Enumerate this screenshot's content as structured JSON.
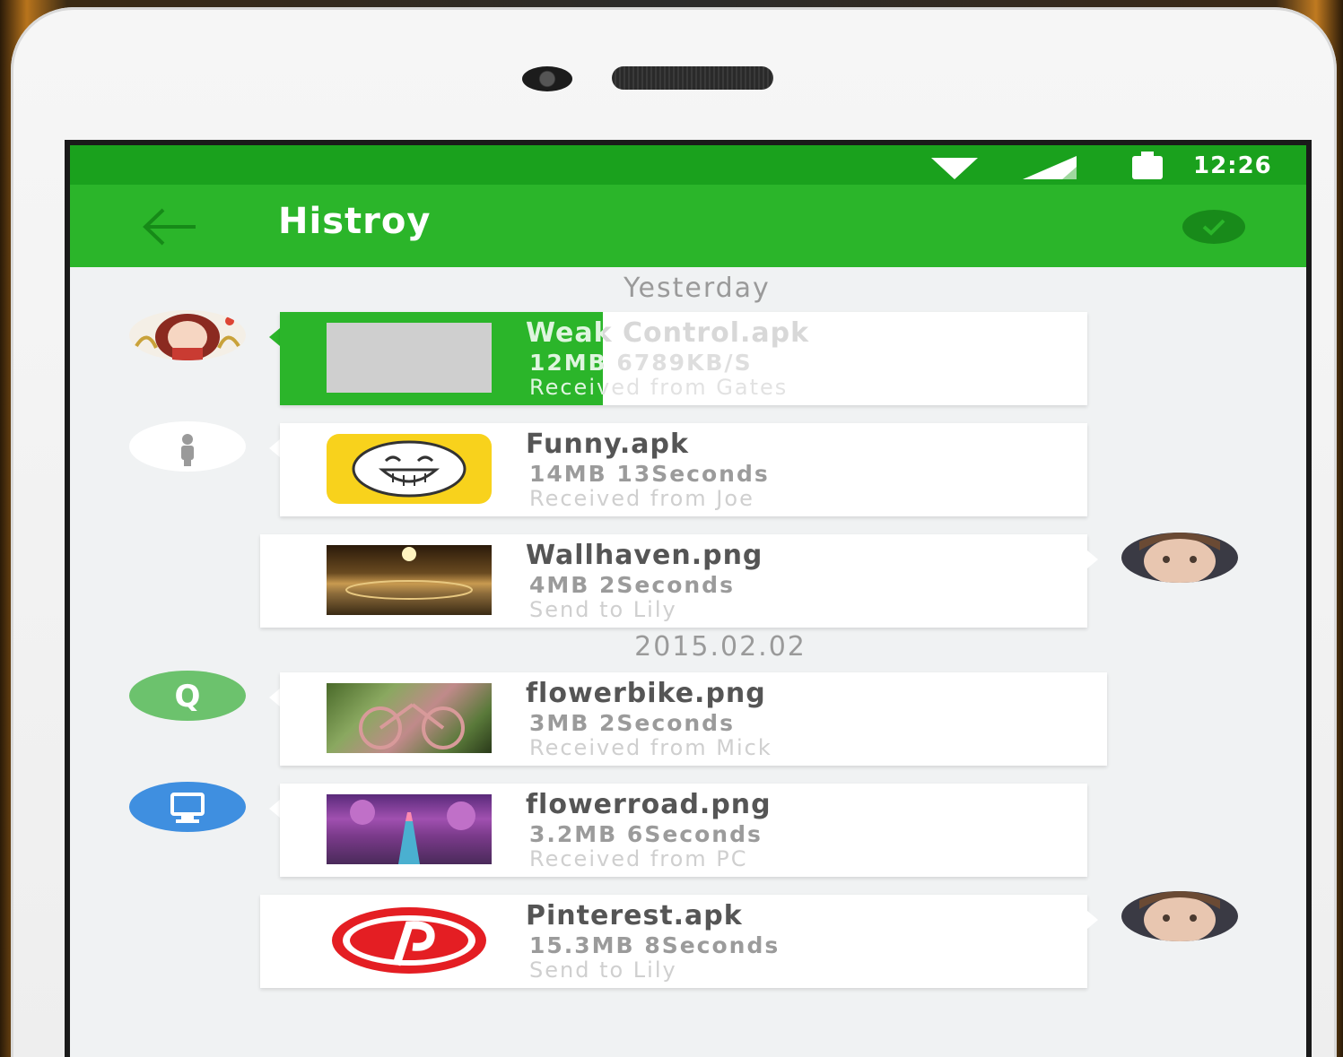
{
  "status": {
    "time": "12:26"
  },
  "appbar": {
    "title": "Histroy"
  },
  "colors": {
    "primary": "#2bb52a",
    "status_bar": "#1aa11d",
    "check_badge": "#188a1a",
    "background": "#f0f2f3"
  },
  "groups": [
    {
      "date": "Yesterday"
    },
    {
      "date": "2015.02.02"
    }
  ],
  "items": [
    {
      "name": "Weak Control.apk",
      "meta": "12MB 6789KB/S",
      "detail": "Received from Gates",
      "direction": "received",
      "progress": 0.4,
      "avatar_icon": "girl-avatar-icon",
      "thumb_icon": "placeholder-thumb"
    },
    {
      "name": "Funny.apk",
      "meta": "14MB 13Seconds",
      "detail": "Received from Joe",
      "direction": "received",
      "avatar_icon": "person-icon",
      "thumb_icon": "laughing-face-icon"
    },
    {
      "name": "Wallhaven.png",
      "meta": "4MB 2Seconds",
      "detail": "Send to Lily",
      "direction": "sent",
      "avatar_icon": "lily-avatar-icon",
      "thumb_icon": "wallpaper-thumb"
    },
    {
      "name": "flowerbike.png",
      "meta": "3MB 2Seconds",
      "detail": "Received from Mick",
      "direction": "received",
      "avatar_icon": "q-badge-icon",
      "avatar_letter": "Q",
      "thumb_icon": "flower-bike-thumb"
    },
    {
      "name": "flowerroad.png",
      "meta": "3.2MB 6Seconds",
      "detail": "Received from PC",
      "direction": "received",
      "avatar_icon": "monitor-icon",
      "thumb_icon": "flower-road-thumb"
    },
    {
      "name": "Pinterest.apk",
      "meta": "15.3MB 8Seconds",
      "detail": "Send to Lily",
      "direction": "sent",
      "avatar_icon": "lily-avatar-icon",
      "thumb_icon": "pinterest-icon"
    }
  ]
}
